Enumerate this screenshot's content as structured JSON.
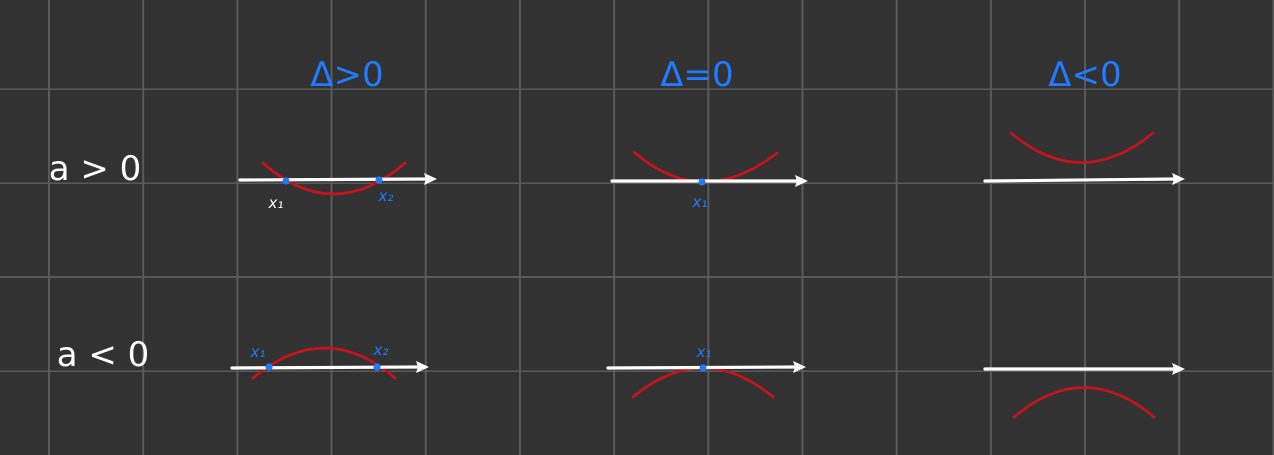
{
  "columns": [
    {
      "label": "Δ>0"
    },
    {
      "label": "Δ=0"
    },
    {
      "label": "Δ<0"
    }
  ],
  "rows": [
    {
      "label": "a > 0"
    },
    {
      "label": "a < 0"
    }
  ],
  "roots": {
    "r1c1_x1": "x₁",
    "r1c1_x2": "x₂",
    "r1c2_x1": "x₁",
    "r2c1_x1": "x₁",
    "r2c1_x2": "x₂",
    "r2c2_x1": "x₁"
  },
  "colors": {
    "background": "#323232",
    "grid": "#5a5a5a",
    "axis": "#ffffff",
    "parabola": "#c8121a",
    "accent": "#1f7bff"
  }
}
